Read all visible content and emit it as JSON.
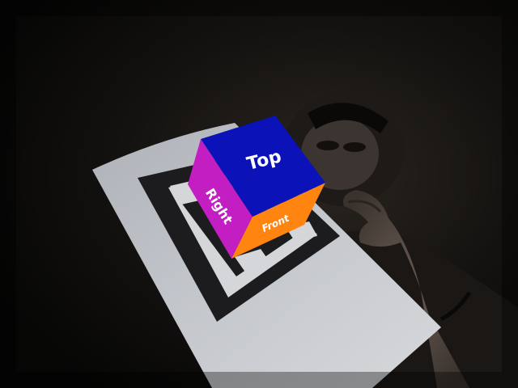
{
  "cube": {
    "top_label": "Top",
    "right_label": "Right",
    "front_label": "Front",
    "colors": {
      "top": "#0a12b8",
      "right": "#c21ec2",
      "front": "#ff8410"
    }
  },
  "scene": {
    "background": "#0d0c0a",
    "marker_paper": "#c8cacd",
    "marker_ink": "#1a1a1a"
  }
}
